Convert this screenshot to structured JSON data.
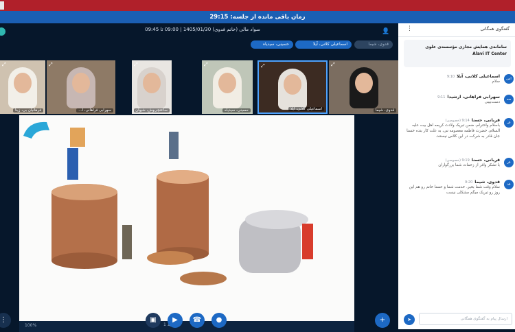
{
  "timer": {
    "text": "زمان باقی مانده از جلسه: 29:15"
  },
  "meeting": {
    "title": "سواد مالی (خانم فدوی) 1405/01/30 | 09:00 تا 09:45",
    "pills": [
      "قدوی، شیما",
      "اسماعیلی کلانی، آیلا",
      "حسینی، سیدیاه"
    ]
  },
  "participants": [
    {
      "name": "فرهانیان بی، زینا"
    },
    {
      "name": "سهرابی فراهانی، ا..."
    },
    {
      "name": "ساعتچی‌وش، شیوان"
    },
    {
      "name": "حسینی، سیدیاه"
    },
    {
      "name": "اسماعیلی کلانی، آیلا"
    },
    {
      "name": "قدوی، شیما"
    }
  ],
  "slidebar": {
    "nav": "اسلاید 1",
    "zoom": "100%"
  },
  "chat": {
    "title": "گفتگوی همگانی",
    "welcome_line1": "سامانه‌ی همایش مجازی مؤسسه‌ی علوی",
    "welcome_line2": "Alavi IT Center",
    "messages": [
      {
        "avatar": "اس",
        "name": "اسماعیلی کلانی، آیلا",
        "time": "9:10",
        "text": "سلام"
      },
      {
        "avatar": "سه",
        "name": "سهرابی فراهانی، ارشیدا",
        "time": "9:11",
        "text": "دست‌بیبی"
      },
      {
        "avatar": "قر",
        "name": "قربانی، حسنا",
        "time": "9:14 (خصوصی)",
        "text": "باسلام واحترام، ضمن تبریک ولادت کریمه اهل بیت علیه السلام، حضرت فاطمه معصومه س، به علت کار بنده حسنا جان قادر به شرکت در این کلاس نیستند."
      },
      {
        "avatar": "قر",
        "name": "قربانی، حسنا",
        "time": "9:19 (خصوصی)",
        "text": "با تشکر وافر از زحمات شما بزرگواران"
      },
      {
        "avatar": "قد",
        "name": "قدوی، شیما",
        "time": "9:20",
        "text": "سلام وقت شما بخیر. خدمت شما و حسنا خانم رو هم این روز رو تبریک میگم مشکلی نیست"
      }
    ],
    "input_placeholder": "ارسال پیام به گفتگوی همگانی"
  }
}
